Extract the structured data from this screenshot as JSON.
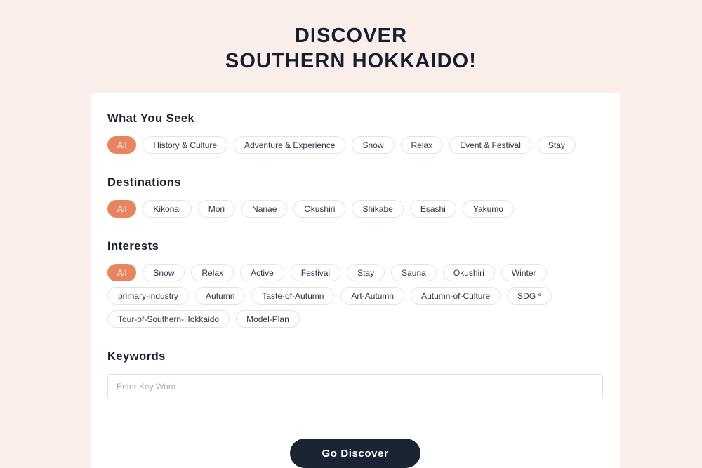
{
  "theme": {
    "page_background": "#faeeeb",
    "card_background": "#ffffff",
    "accent": "#e8845f",
    "text_dark": "#161f2e",
    "button_background": "#1b2433"
  },
  "hero": {
    "line1": "DISCOVER",
    "line2": "SOUTHERN HOKKAIDO!"
  },
  "sections": {
    "what_you_seek": {
      "title": "What You Seek",
      "chips": [
        {
          "label": "All",
          "selected": true
        },
        {
          "label": "History & Culture",
          "selected": false
        },
        {
          "label": "Adventure & Experience",
          "selected": false
        },
        {
          "label": "Snow",
          "selected": false
        },
        {
          "label": "Relax",
          "selected": false
        },
        {
          "label": "Event & Festival",
          "selected": false
        },
        {
          "label": "Stay",
          "selected": false
        }
      ]
    },
    "destinations": {
      "title": "Destinations",
      "chips": [
        {
          "label": "All",
          "selected": true
        },
        {
          "label": "Kikonai",
          "selected": false
        },
        {
          "label": "Mori",
          "selected": false
        },
        {
          "label": "Nanae",
          "selected": false
        },
        {
          "label": "Okushiri",
          "selected": false
        },
        {
          "label": "Shikabe",
          "selected": false
        },
        {
          "label": "Esashi",
          "selected": false
        },
        {
          "label": "Yakumo",
          "selected": false
        }
      ]
    },
    "interests": {
      "title": "Interests",
      "chips": [
        {
          "label": "All",
          "selected": true
        },
        {
          "label": "Snow",
          "selected": false
        },
        {
          "label": "Relax",
          "selected": false
        },
        {
          "label": "Active",
          "selected": false
        },
        {
          "label": "Festival",
          "selected": false
        },
        {
          "label": "Stay",
          "selected": false
        },
        {
          "label": "Sauna",
          "selected": false
        },
        {
          "label": "Okushiri",
          "selected": false
        },
        {
          "label": "Winter",
          "selected": false
        },
        {
          "label": "primary-industry",
          "selected": false
        },
        {
          "label": "Autumn",
          "selected": false
        },
        {
          "label": "Taste-of-Autumn",
          "selected": false
        },
        {
          "label": "Art-Autumn",
          "selected": false
        },
        {
          "label": "Autumn-of-Culture",
          "selected": false
        },
        {
          "label": "SDG",
          "sub": "s",
          "selected": false
        },
        {
          "label": "Tour-of-Southern-Hokkaido",
          "selected": false
        },
        {
          "label": "Model-Plan",
          "selected": false
        }
      ]
    },
    "keywords": {
      "title": "Keywords",
      "placeholder": "Enter Key Word",
      "value": ""
    }
  },
  "submit": {
    "label": "Go Discover"
  }
}
